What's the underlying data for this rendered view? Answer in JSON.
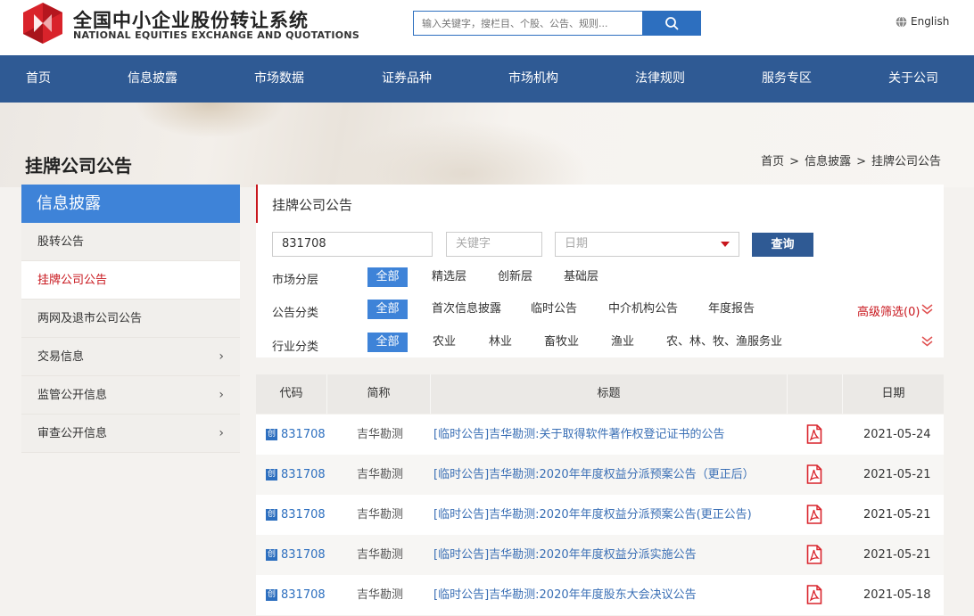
{
  "brand": {
    "name_cn": "全国中小企业股份转让系统",
    "name_en": "NATIONAL EQUITIES EXCHANGE AND QUOTATIONS"
  },
  "search": {
    "placeholder": "输入关键字，搜栏目、个股、公告、规则..."
  },
  "lang": {
    "label": "English"
  },
  "nav": [
    "首页",
    "信息披露",
    "市场数据",
    "证券品种",
    "市场机构",
    "法律规则",
    "服务专区",
    "关于公司"
  ],
  "page": {
    "title": "挂牌公司公告"
  },
  "breadcrumb": [
    "首页",
    "信息披露",
    "挂牌公司公告"
  ],
  "sidebar": {
    "heading": "信息披露",
    "items": [
      {
        "label": "股转公告",
        "arrow": ""
      },
      {
        "label": "挂牌公司公告",
        "arrow": ""
      },
      {
        "label": "两网及退市公司公告",
        "arrow": ""
      },
      {
        "label": "交易信息",
        "arrow": "›"
      },
      {
        "label": "监管公开信息",
        "arrow": "›"
      },
      {
        "label": "审查公开信息",
        "arrow": "›"
      }
    ]
  },
  "panel": {
    "title": "挂牌公司公告",
    "code_value": "831708",
    "keyword_placeholder": "关键字",
    "date_placeholder": "日期",
    "query_label": "查询",
    "advanced_label": "高级筛选(0)"
  },
  "filters": {
    "market": {
      "label": "市场分层",
      "options": [
        "全部",
        "精选层",
        "创新层",
        "基础层"
      ]
    },
    "type": {
      "label": "公告分类",
      "options": [
        "全部",
        "首次信息披露",
        "临时公告",
        "中介机构公告",
        "年度报告"
      ]
    },
    "industry": {
      "label": "行业分类",
      "options": [
        "全部",
        "农业",
        "林业",
        "畜牧业",
        "渔业",
        "农、林、牧、渔服务业"
      ]
    }
  },
  "table": {
    "headers": [
      "代码",
      "简称",
      "标题",
      "日期"
    ],
    "rows": [
      {
        "badge": "创",
        "code": "831708",
        "name": "吉华勘测",
        "title": "[临时公告]吉华勘测:关于取得软件著作权登记证书的公告",
        "date": "2021-05-24"
      },
      {
        "badge": "创",
        "code": "831708",
        "name": "吉华勘测",
        "title": "[临时公告]吉华勘测:2020年年度权益分派预案公告（更正后）",
        "date": "2021-05-21"
      },
      {
        "badge": "创",
        "code": "831708",
        "name": "吉华勘测",
        "title": "[临时公告]吉华勘测:2020年年度权益分派预案公告(更正公告)",
        "date": "2021-05-21"
      },
      {
        "badge": "创",
        "code": "831708",
        "name": "吉华勘测",
        "title": "[临时公告]吉华勘测:2020年年度权益分派实施公告",
        "date": "2021-05-21"
      },
      {
        "badge": "创",
        "code": "831708",
        "name": "吉华勘测",
        "title": "[临时公告]吉华勘测:2020年年度股东大会决议公告",
        "date": "2021-05-18"
      }
    ]
  },
  "colors": {
    "nav": "#2f5a94",
    "accent_blue": "#3e83d8",
    "accent_red": "#c8161d",
    "link": "#3a6fb5"
  }
}
